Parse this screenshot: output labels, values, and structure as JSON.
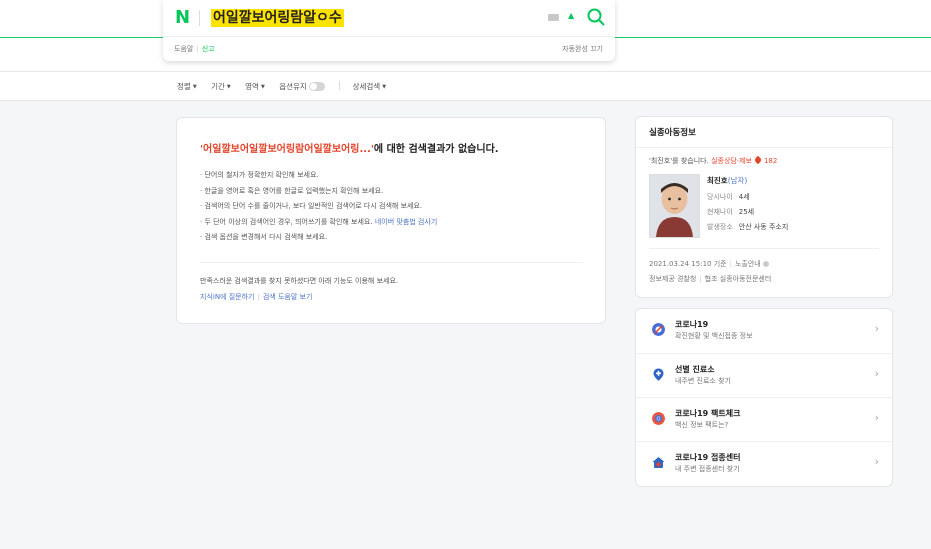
{
  "search": {
    "logo": "N",
    "query": "어일깔보어링람알ㅇ수",
    "help": "도움말",
    "report": "신고",
    "autocomplete_off": "자동완성 끄기"
  },
  "filters": [
    {
      "label": "정렬"
    },
    {
      "label": "기간"
    },
    {
      "label": "영역"
    },
    {
      "label": "옵션유지"
    },
    {
      "label": "상세검색"
    }
  ],
  "no_result": {
    "query": "'어일깔보어일깔보어링람어일깔보어링...'",
    "message": "에 대한 검색결과가 없습니다.",
    "tips": [
      "· 단어의 철자가 정확한지 확인해 보세요.",
      "· 한글을 영어로 혹은 영어를 한글로 입력했는지 확인해 보세요.",
      "· 검색어의 단어 수를 줄이거나, 보다 일반적인 검색어로 다시 검색해 보세요.",
      "· 두 단어 이상의 검색어인 경우, 띄어쓰기를 확인해 보세요.",
      "· 검색 옵션을 변경해서 다시 검색해 보세요."
    ],
    "tip4_link": "네이버 맞춤법 검사기",
    "more_text": "만족스러운 검색결과를 찾지 못하셨다면 아래 기능도 이용해 보세요.",
    "link_kin": "지식iN에 질문하기",
    "link_help": "검색 도움말 보기"
  },
  "missing_child": {
    "title": "실종아동정보",
    "find_text": "'최진호'를 찾습니다.",
    "report_text": "실종상담·제보",
    "phone": "182",
    "name": "최진호",
    "gender": "(남자)",
    "rows": [
      {
        "label": "당시나이",
        "value": "4세"
      },
      {
        "label": "현재나이",
        "value": "25세"
      },
      {
        "label": "발생장소",
        "value": "안산 사동 주소지"
      }
    ],
    "date": "2021.03.24 15:10 기준",
    "notice": "노출안내",
    "provider": "정보제공 경찰청",
    "support": "협조 실종아동전문센터"
  },
  "covid": [
    {
      "title": "코로나19",
      "subtitle": "확진현황 및 백신접종 정보",
      "icon": "virus-icon",
      "color": "#4b6cd6"
    },
    {
      "title": "선별 진료소",
      "subtitle": "내주변 진료소 찾기",
      "icon": "location-pin-icon",
      "color": "#2f65c4"
    },
    {
      "title": "코로나19 팩트체크",
      "subtitle": "백신 정보 팩트는?",
      "icon": "factcheck-icon",
      "color": "#e9573f"
    },
    {
      "title": "코로나19 접종센터",
      "subtitle": "내 주변 접종센터 찾기",
      "icon": "hospital-icon",
      "color": "#2f65c4"
    }
  ]
}
